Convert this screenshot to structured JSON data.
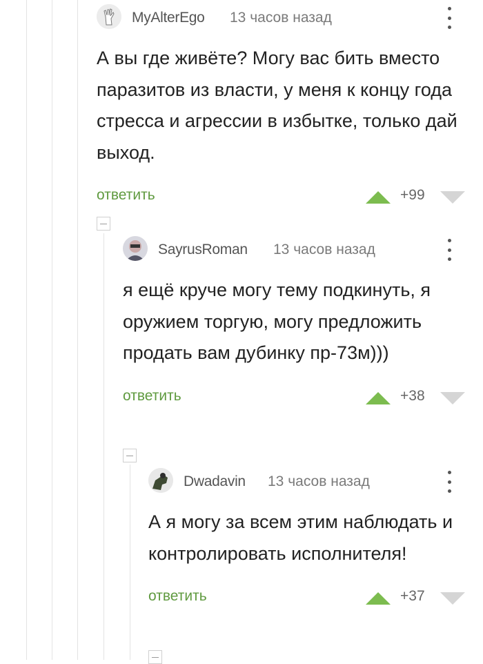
{
  "comments": [
    {
      "username": "MyAlterEgo",
      "time": "13 часов назад",
      "text": "А вы где живёте? Могу вас бить вместо паразитов из власти, у меня к концу года стресса и агрессии в избытке, только дай выход.",
      "reply_label": "ответить",
      "rating": "+99"
    },
    {
      "username": "SayrusRoman",
      "time": "13 часов назад",
      "text": "я ещё круче могу тему подкинуть, я оружием торгую, могу предложить продать вам дубинку пр-73м)))",
      "reply_label": "ответить",
      "rating": "+38"
    },
    {
      "username": "Dwadavin",
      "time": "13 часов назад",
      "text": "А я могу за всем этим наблюдать и контролировать исполнителя!",
      "reply_label": "ответить",
      "rating": "+37"
    }
  ],
  "colors": {
    "reply_link": "#5f9a3f",
    "upvote": "#7cbc4f",
    "downvote": "#d5d5d5",
    "thread_line": "#e3e3e3"
  },
  "icons": [
    "avatar",
    "more-options-icon",
    "upvote-icon",
    "downvote-icon",
    "collapse-thread-icon"
  ]
}
